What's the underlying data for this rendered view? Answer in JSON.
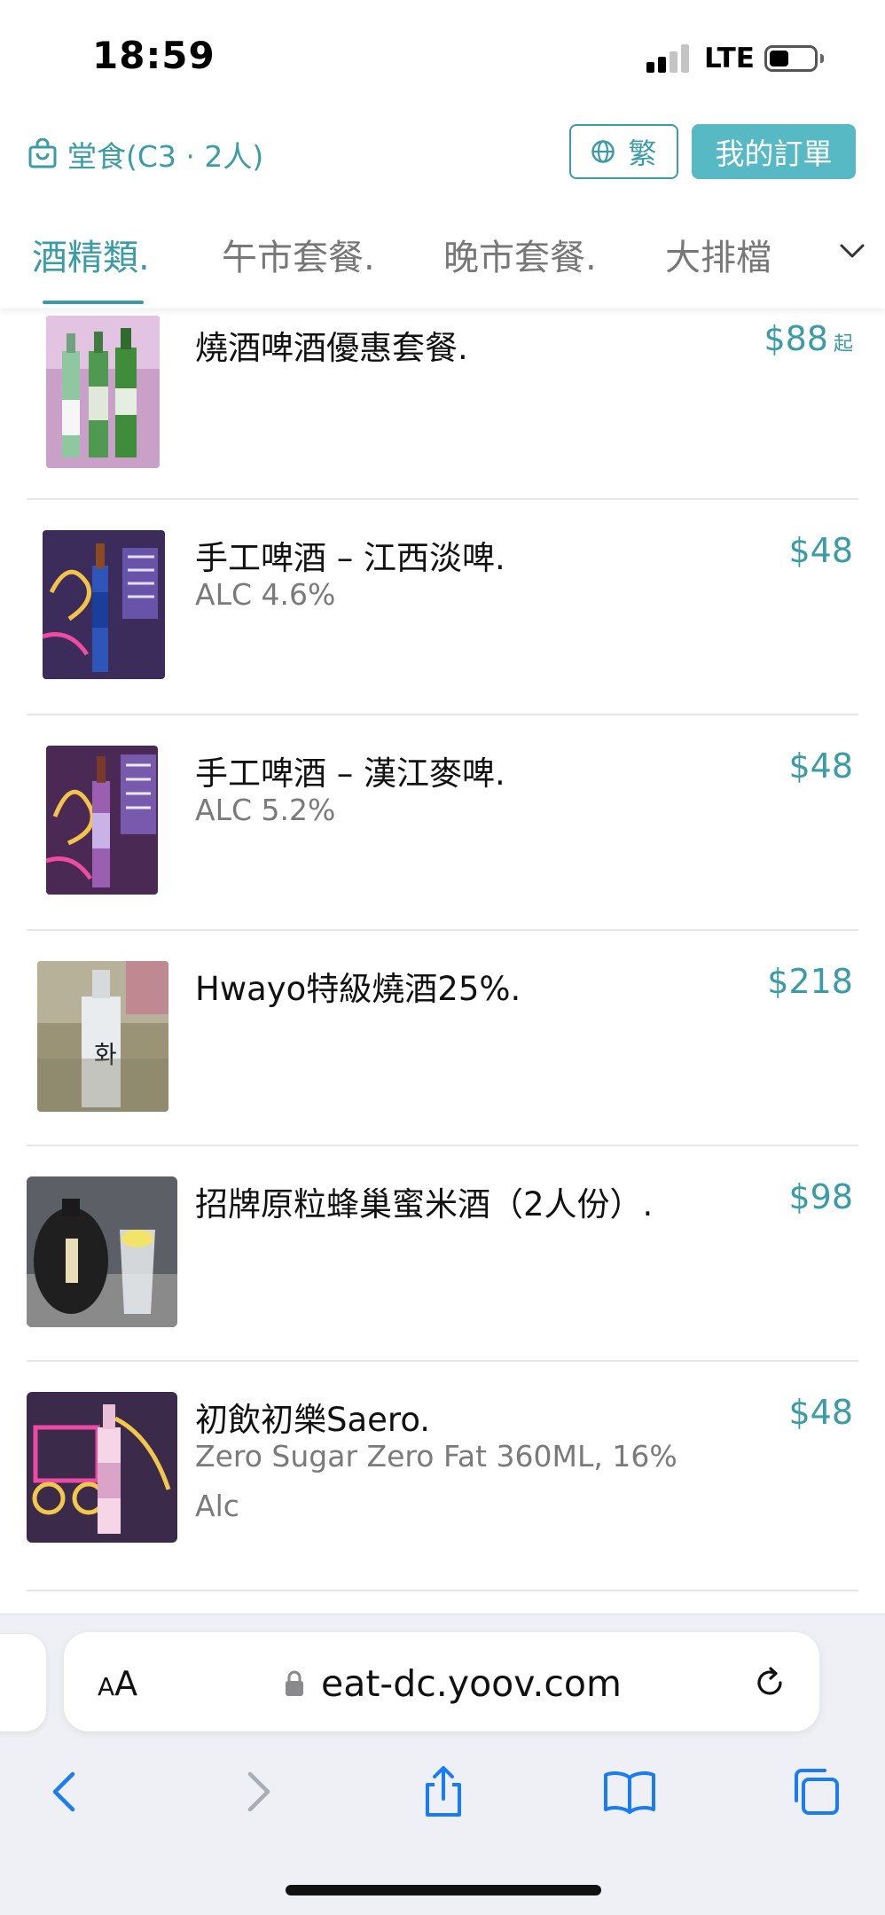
{
  "status_bar": {
    "time": "18:59",
    "network": "LTE"
  },
  "header": {
    "dine_in_label": "堂食(C3 · 2人)",
    "language_label": "繁",
    "orders_label": "我的訂單"
  },
  "tabs": [
    {
      "label": "酒精類."
    },
    {
      "label": "午市套餐."
    },
    {
      "label": "晚市套餐."
    },
    {
      "label": "大排檔"
    }
  ],
  "items": [
    {
      "name": "燒酒啤酒優惠套餐.",
      "desc": "",
      "price": "$88",
      "price_suffix": "起"
    },
    {
      "name": "手工啤酒 – 江西淡啤.",
      "desc": "ALC 4.6%",
      "price": "$48",
      "price_suffix": ""
    },
    {
      "name": "手工啤酒 – 漢江麥啤.",
      "desc": "ALC 5.2%",
      "price": "$48",
      "price_suffix": ""
    },
    {
      "name": "Hwayo特級燒酒25%.",
      "desc": "",
      "price": "$218",
      "price_suffix": ""
    },
    {
      "name": "招牌原粒蜂巢蜜米酒（2人份）.",
      "desc": "",
      "price": "$98",
      "price_suffix": ""
    },
    {
      "name": "初飲初樂Saero.",
      "desc": "Zero Sugar Zero Fat 360ML, 16% Alc",
      "price": "$48",
      "price_suffix": ""
    }
  ],
  "browser": {
    "text_size_label_small": "A",
    "text_size_label_large": "A",
    "url": "eat-dc.yoov.com"
  },
  "colors": {
    "accent": "#3a9ca6",
    "accent_button": "#56b9c3",
    "ios_blue": "#1a7cf5"
  }
}
